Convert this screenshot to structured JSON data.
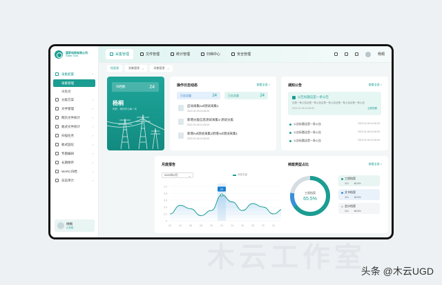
{
  "watermark": "木云工作室",
  "caption": "头条 @木云UGD",
  "brand": {
    "cn": "国家电网有限公司",
    "en": "State Grid",
    "color": "#1b9d92"
  },
  "sidebar": {
    "group": "采集配置",
    "subs": [
      "采集管理",
      "采集组"
    ],
    "items": [
      "分类方案",
      "文件管理",
      "网页文件统计",
      "板式文件统计",
      "扫描任务",
      "板式固化",
      "专题编研",
      "长期保存",
      "WARC归档",
      "日志审计"
    ]
  },
  "user": {
    "name": "杨桐",
    "status": "● 在线"
  },
  "topbar": {
    "tabs": [
      "采集管理",
      "文件管理",
      "统计管理",
      "归档中心",
      "安全管理"
    ],
    "user_name": "杨桐"
  },
  "breadcrumbs": [
    "档案源",
    "采集管理",
    "采集管理"
  ],
  "hero": {
    "badge_label": "归档数",
    "badge_value": "24",
    "name": "杨桐",
    "desc": "你好，祝你开心每一天"
  },
  "ops": {
    "title": "操作日志动态",
    "more": "查看全部 >",
    "stats": [
      {
        "label": "日志总量",
        "value": "24"
      },
      {
        "label": "日志总量",
        "value": "24"
      }
    ],
    "items": [
      {
        "title": "启动采集null测试采集1",
        "date": "2022.01.06 01:06:09"
      },
      {
        "title": "新增分类信息测试采集1-测试分类",
        "date": "2022.01.06 01:06:09"
      },
      {
        "title": "新增null测试采集1新增null测试采集1",
        "date": "2022.01.06 01:06:09"
      }
    ]
  },
  "notice": {
    "title": "通知公告",
    "more": "查看全部 >",
    "highlight": {
      "title": "公告标题这是一条公告",
      "content": "这是一条公告这是一条公告这是一条公告这是一条公告这是一条公告",
      "date": "2022.01.06 01:06:09",
      "link": "立即查看"
    },
    "rows": [
      {
        "title": "公告标题这是一条公告",
        "date": "2022.01.06 01:06:09"
      },
      {
        "title": "公告标题这是一条公告",
        "date": "2022.01.06 01:06:09"
      },
      {
        "title": "公告标题这是一条公告",
        "date": "2022.01.06 01:06:09"
      }
    ]
  },
  "month": {
    "title": "月度报告",
    "select": "2022年2月",
    "select_arrow": "⌄",
    "legend": "消息总量",
    "tooltip": "29"
  },
  "types": {
    "title": "档案类型占比",
    "more": "查看全部 >",
    "center_label": "工程档案",
    "center_value": "65.5%",
    "legend": [
      {
        "name": "工程档案",
        "count": "113",
        "pct": "65.5%",
        "color": "#1b9d92"
      },
      {
        "name": "文书档案",
        "count": "113",
        "pct": "65.5%",
        "color": "#3a8fd9"
      },
      {
        "name": "会计档案",
        "count": "113",
        "pct": "65.5%",
        "color": "#d4dde2"
      }
    ]
  },
  "chart_data": {
    "type": "area",
    "x": [
      "02",
      "04",
      "06",
      "08",
      "10",
      "12",
      "14",
      "16",
      "18",
      "20",
      "22",
      "24",
      "26",
      "28",
      "30"
    ],
    "y_ticks": [
      "0",
      "0.2",
      "0.4",
      "0.6",
      "0.8",
      "1.0"
    ],
    "ylim": [
      0,
      1.0
    ],
    "values": [
      0.2,
      0.45,
      0.35,
      0.15,
      0.3,
      0.75,
      0.55,
      0.3,
      0.5,
      0.4,
      0.2,
      0.35,
      0.45,
      0.4,
      0.15
    ],
    "highlight_index": 5,
    "grid": true,
    "color": "#1b9d92"
  }
}
